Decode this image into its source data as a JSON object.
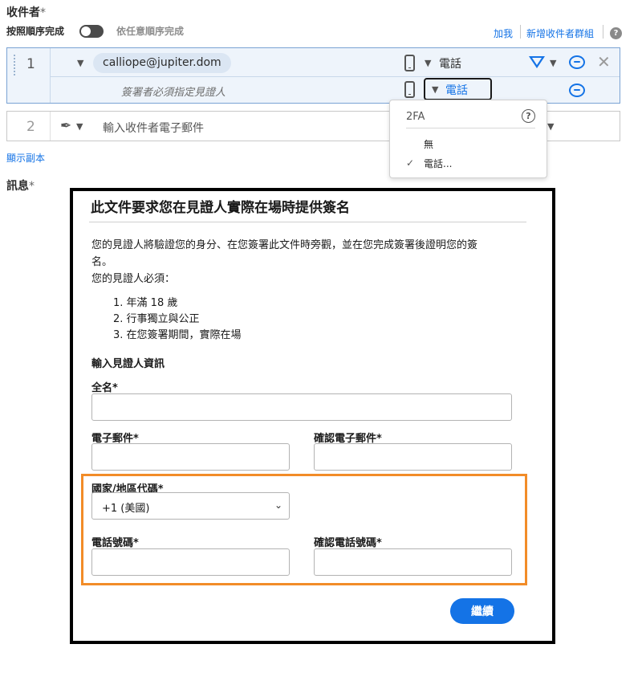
{
  "header": {
    "title": "收件者",
    "required_mark": "*",
    "order_label": "按照順序完成",
    "any_order_label": "依任意順序完成",
    "cc_link": "加我",
    "add_group_link": "新增收件者群組",
    "help_glyph": "?"
  },
  "recipient1": {
    "number": "1",
    "email": "calliope@jupiter.dom",
    "auth_method": "電話",
    "witness_hint": "簽署者必須指定見證人",
    "witness_auth_method": "電話"
  },
  "recipient2": {
    "number": "2",
    "email_placeholder": "輸入收件者電子郵件"
  },
  "auth_dropdown": {
    "header": "2FA",
    "options": [
      "無",
      "電話..."
    ],
    "selected": "電話...",
    "check_glyph": "✓"
  },
  "show_cc_link": "顯示副本",
  "message_label": "訊息",
  "witness_form": {
    "title": "此文件要求您在見證人實際在場時提供簽名",
    "intro_line1": "您的見證人將驗證您的身分、在您簽署此文件時旁觀，並在您完成簽署後證明您的簽",
    "intro_line2": "名。",
    "requirements_title": "您的見證人必須：",
    "requirements": [
      "1. 年滿 18 歲",
      "2. 行事獨立與公正",
      "3. 在您簽署期間，實際在場"
    ],
    "section_title": "輸入見證人資訊",
    "full_name_label": "全名*",
    "email_label": "電子郵件*",
    "confirm_email_label": "確認電子郵件*",
    "country_code_label": "國家/地區代碼*",
    "country_code_value": "+1 (美國)",
    "phone_label": "電話號碼*",
    "confirm_phone_label": "確認電話號碼*",
    "continue_button": "繼續"
  },
  "colors": {
    "accent": "#1473e6",
    "highlight": "#f28c28",
    "row_selected_bg": "#eef4fb"
  }
}
